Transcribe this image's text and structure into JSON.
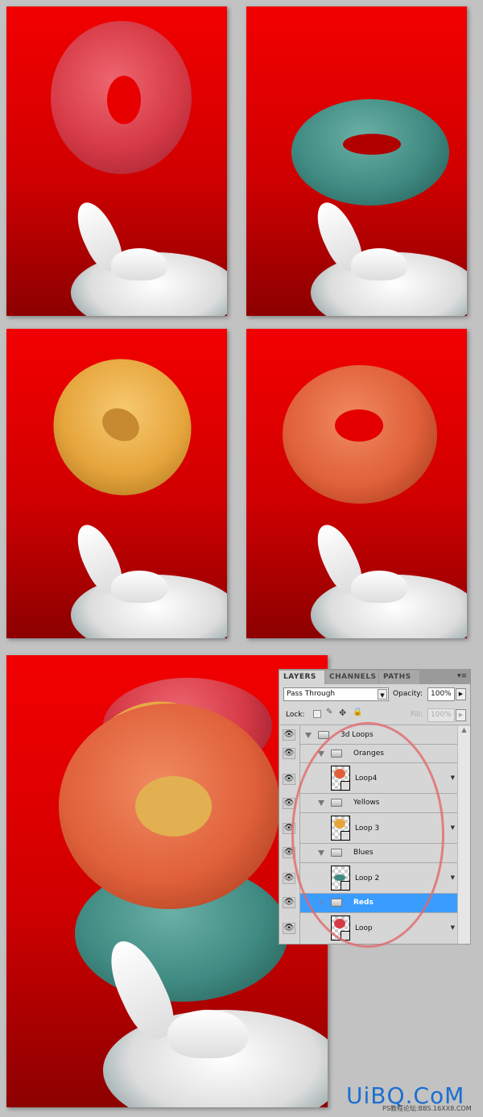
{
  "layers_panel": {
    "tabs": [
      "LAYERS",
      "CHANNELS",
      "PATHS"
    ],
    "blend_mode": "Pass Through",
    "opacity_label": "Opacity:",
    "opacity_value": "100%",
    "lock_label": "Lock:",
    "fill_label": "Fill:",
    "fill_value": "100%",
    "layers": [
      {
        "name": "3d Loops",
        "type": "group",
        "visible": true
      },
      {
        "name": "Oranges",
        "type": "group",
        "visible": true
      },
      {
        "name": "Loop4",
        "type": "3d-layer",
        "visible": true
      },
      {
        "name": "Yellows",
        "type": "group",
        "visible": true
      },
      {
        "name": "Loop 3",
        "type": "3d-layer",
        "visible": true
      },
      {
        "name": "Blues",
        "type": "group",
        "visible": true
      },
      {
        "name": "Loop 2",
        "type": "3d-layer",
        "visible": true
      },
      {
        "name": "Reds",
        "type": "group",
        "visible": true,
        "selected": true
      },
      {
        "name": "Loop",
        "type": "3d-layer",
        "visible": true
      }
    ],
    "selected_color": "#3b9cff"
  },
  "watermark": {
    "logo": "UiBQ.CoM",
    "sub": "PS教程论坛:BBS.16XX8.COM",
    "color": "#1a6fd1"
  },
  "colors": {
    "background": "#f20000",
    "red_loop": "#d8404a",
    "blue_loop": "#3f8a82",
    "yellow_loop": "#e6a53c",
    "orange_loop": "#e0603a",
    "annotation_circle": "#e06a6a"
  }
}
